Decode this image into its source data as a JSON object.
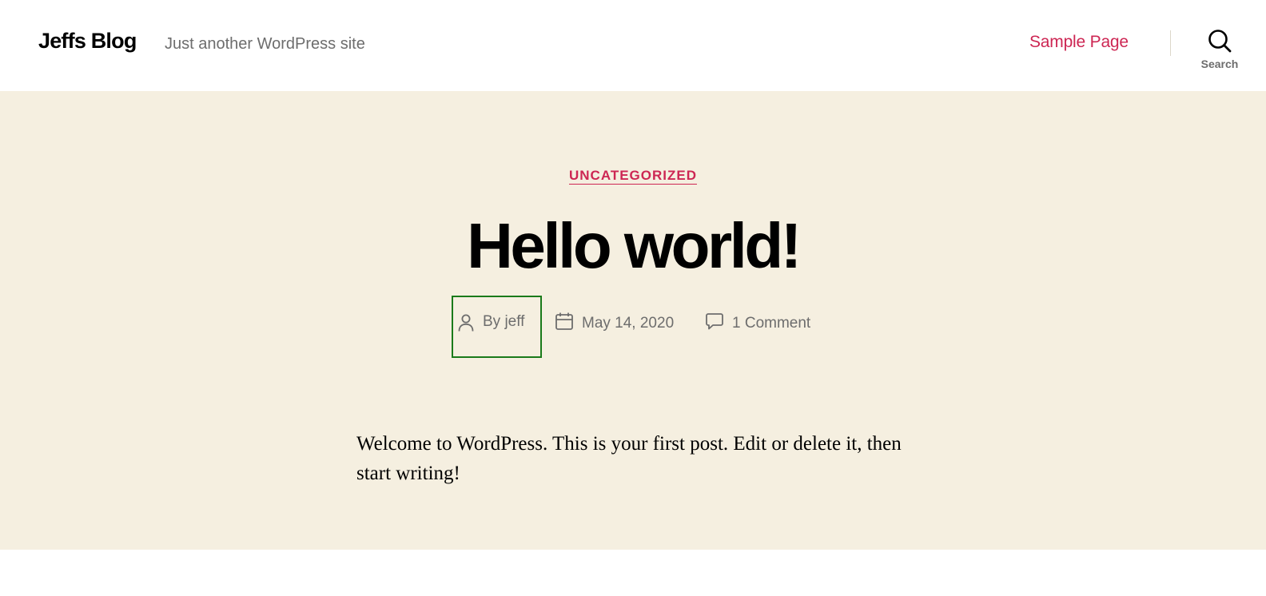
{
  "header": {
    "site_title": "Jeffs Blog",
    "site_description": "Just another WordPress site",
    "nav": [
      {
        "label": "Sample Page"
      }
    ],
    "search_label": "Search"
  },
  "post": {
    "category": "UNCATEGORIZED",
    "title": "Hello world!",
    "meta": {
      "author": "By jeff",
      "date": "May 14, 2020",
      "comments": "1 Comment"
    },
    "content": "Welcome to WordPress. This is your first post. Edit or delete it, then start writing!"
  },
  "colors": {
    "accent": "#cd2653",
    "header_background": "#f5efe0",
    "meta_text": "#6d6d6d",
    "focus_outline": "#1a7a1a"
  },
  "icons": {
    "author": "user-icon",
    "date": "calendar-icon",
    "comments": "comment-icon",
    "search": "search-icon"
  }
}
